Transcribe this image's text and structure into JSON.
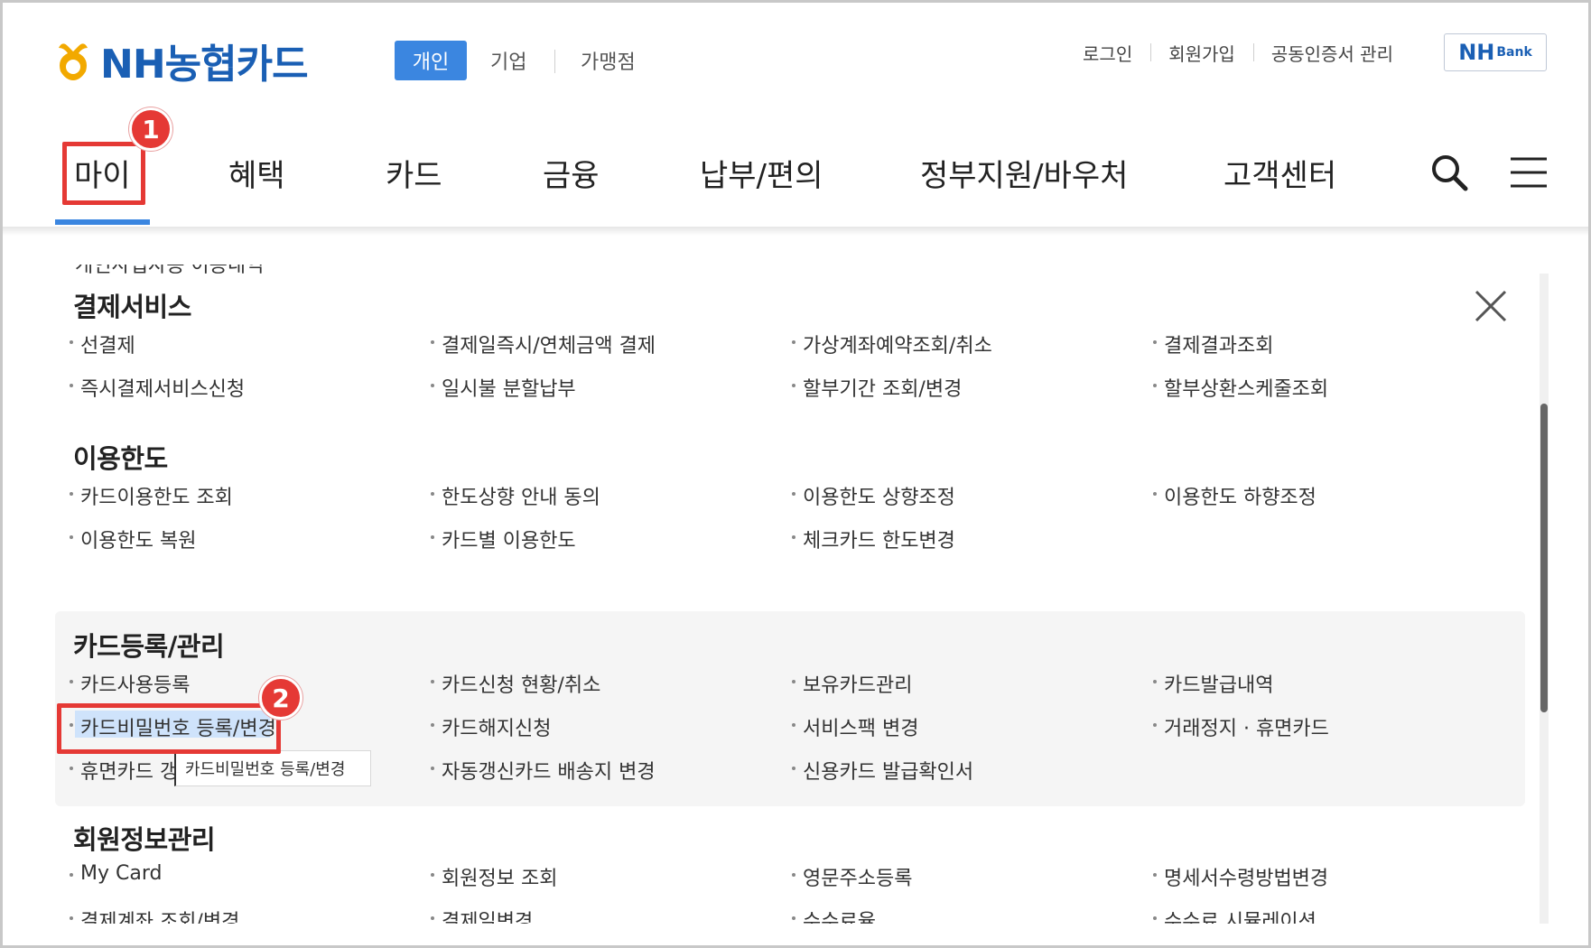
{
  "header": {
    "brand": "NH농협카드",
    "segments": {
      "personal": "개인",
      "business": "기업",
      "merchant": "가맹점"
    },
    "top_links": [
      "로그인",
      "회원가입",
      "공동인증서 관리"
    ],
    "nhbank": {
      "main": "NH",
      "sub": "Bank"
    }
  },
  "nav": {
    "items": [
      "마이",
      "혜택",
      "카드",
      "금융",
      "납부/편의",
      "정부지원/바우처",
      "고객센터"
    ],
    "active": "마이"
  },
  "annotations": {
    "badge1": "1",
    "badge2": "2"
  },
  "menu": {
    "cut_title": "개인사업자용 이용내역",
    "sections": [
      {
        "title": "결제서비스",
        "items": [
          "선결제",
          "결제일즉시/연체금액 결제",
          "가상계좌예약조회/취소",
          "결제결과조회",
          "즉시결제서비스신청",
          "일시불 분할납부",
          "할부기간 조회/변경",
          "할부상환스케줄조회"
        ]
      },
      {
        "title": "이용한도",
        "items": [
          "카드이용한도 조회",
          "한도상향 안내 동의",
          "이용한도 상향조정",
          "이용한도 하향조정",
          "이용한도 복원",
          "카드별 이용한도",
          "체크카드 한도변경"
        ]
      },
      {
        "title": "카드등록/관리",
        "items": [
          "카드사용등록",
          "카드신청 현황/취소",
          "보유카드관리",
          "카드발급내역",
          "카드비밀번호 등록/변경",
          "카드해지신청",
          "서비스팩 변경",
          "거래정지 · 휴면카드",
          "휴면카드 갱",
          "자동갱신카드 배송지 변경",
          "신용카드 발급확인서"
        ]
      },
      {
        "title": "회원정보관리",
        "items": [
          "My Card",
          "회원정보 조회",
          "영문주소등록",
          "명세서수령방법변경",
          "결제계좌 조회/변경",
          "결제일변경",
          "수수료율",
          "수수료 시뮬레이션"
        ]
      }
    ],
    "tooltip": "카드비밀번호 등록/변경"
  },
  "colors": {
    "brand_blue": "#1a5fb4",
    "accent_blue": "#3b86e0",
    "highlight_red": "#e53935",
    "logo_yellow": "#f2a900"
  }
}
